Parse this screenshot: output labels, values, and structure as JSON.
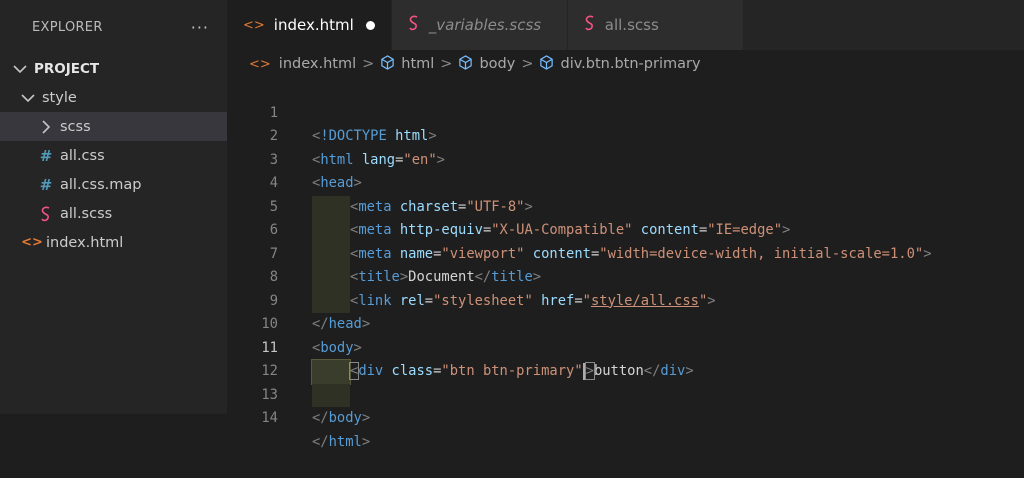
{
  "explorer": {
    "title": "EXPLORER",
    "more": "···",
    "project": "PROJECT",
    "items": [
      {
        "label": "style"
      },
      {
        "label": "scss"
      },
      {
        "label": "all.css"
      },
      {
        "label": "all.css.map"
      },
      {
        "label": "all.scss"
      },
      {
        "label": "index.html"
      }
    ]
  },
  "tabs": [
    {
      "label": "index.html"
    },
    {
      "label": "_variables.scss"
    },
    {
      "label": "all.scss"
    }
  ],
  "breadcrumb": [
    "index.html",
    "html",
    "body",
    "div.btn.btn-primary"
  ],
  "line_numbers": [
    "1",
    "2",
    "3",
    "4",
    "5",
    "6",
    "7",
    "8",
    "9",
    "10",
    "11",
    "12",
    "13",
    "14"
  ],
  "code": {
    "doctype": "!DOCTYPE",
    "html": "html",
    "head": "head",
    "meta": "meta",
    "title": "title",
    "link": "link",
    "body": "body",
    "div": "div",
    "attr_lang": "lang",
    "attr_charset": "charset",
    "attr_http_equiv": "http-equiv",
    "attr_content": "content",
    "attr_name": "name",
    "attr_rel": "rel",
    "attr_href": "href",
    "attr_class": "class",
    "val_en": "\"en\"",
    "val_utf8": "\"UTF-8\"",
    "val_xua": "\"X-UA-Compatible\"",
    "val_ie": "\"IE=edge\"",
    "val_viewport": "\"viewport\"",
    "val_width": "\"width=device-width, initial-scale=1.0\"",
    "val_stylesheet": "\"stylesheet\"",
    "val_href_q1": "\"",
    "val_href": "style/all.css",
    "val_href_q2": "\"",
    "val_class": "\"btn btn-primary",
    "val_class_q": "\"",
    "text_document": "Document",
    "text_button": "button"
  }
}
